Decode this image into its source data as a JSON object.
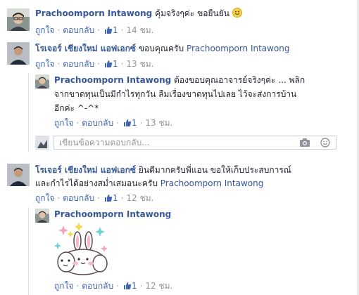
{
  "ui": {
    "like": "ถูกใจ",
    "reply": "ตอบกลับ",
    "dot": "·"
  },
  "comments": [
    {
      "name": "Prachoomporn Intawong",
      "text": "คุ้มจริงๆค่ะ ขอยืนยัน",
      "emoji": "smile-emoji",
      "likes": "1",
      "time": "14 ชม."
    },
    {
      "name": "โรเจอร์ เชียงใหม่ แอฟเอกซ์",
      "text": "ขอบคุณครับ",
      "mention": "Prachoomporn Intawong",
      "likes": "1",
      "time": "13 ชม.",
      "reply": {
        "name": "Prachoomporn Intawong",
        "text1": "ต้องขอบคุณอาจารย์จริงๆค่ะ ... พลิก",
        "text2": "จากขาดทุนเป็นมีกำไรทุกวัน ลืมเรื่องขาดทุนไปเลย ไว้จะส่งการบ้าน",
        "text3": "อีกค่ะ ^-^*",
        "likes": "1",
        "time": "13 ชม."
      },
      "reply_input": {
        "placeholder": "เขียนข้อความตอบกลับ...",
        "camera_icon": "camera-icon",
        "emoji_icon": "emoji-icon"
      }
    },
    {
      "name": "โรเจอร์ เชียงใหม่ แอฟเอกซ์",
      "text": "ยินดีมากครับพี่แอน ขอให้เก็บประสบการณ์",
      "text2": "และกำไรได้อย่างสม่ำเสมอนะครับ",
      "mention": "Prachoomporn Intawong",
      "likes": "1",
      "time": "12 ชม.",
      "reply": {
        "name": "Prachoomporn Intawong",
        "sticker": "bunny-sticker",
        "likes": "1",
        "time": "12 ชม."
      }
    }
  ],
  "colors": {
    "link": "#365899",
    "meta": "#90949c",
    "action": "#4267b2"
  }
}
